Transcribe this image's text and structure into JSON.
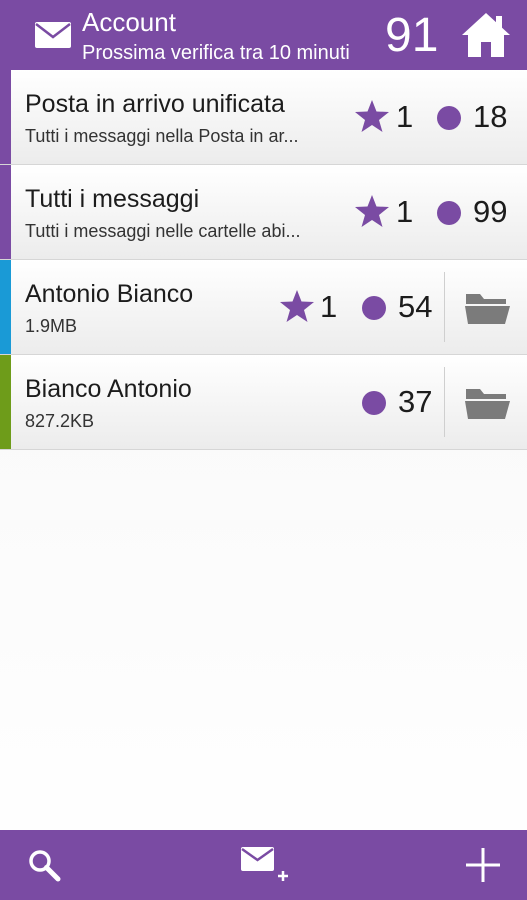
{
  "colors": {
    "brand": "#7a4ba3",
    "unified_stripe": "#7a4ba3",
    "all_stripe": "#7a4ba3",
    "account1_stripe": "#1a9ad6",
    "account2_stripe": "#6e9c1a",
    "badge": "#7a4ba3",
    "folder": "#7b7b7b"
  },
  "header": {
    "title": "Account",
    "subtitle": "Prossima verifica tra 10 minuti",
    "count": "91",
    "mail_icon": "mail-icon",
    "home_icon": "home-icon"
  },
  "accounts": [
    {
      "name": "Posta in arrivo unificata",
      "desc": "Tutti i messaggi nella Posta in ar...",
      "starred": "1",
      "unread": "18"
    },
    {
      "name": "Tutti i messaggi",
      "desc": "Tutti i messaggi nelle cartelle abi...",
      "starred": "1",
      "unread": "99"
    },
    {
      "name": "Antonio Bianco",
      "desc": "1.9MB",
      "starred": "1",
      "unread": "54",
      "icon": "folder-icon"
    },
    {
      "name": "Bianco Antonio",
      "desc": "827.2KB",
      "unread": "37",
      "icon": "folder-icon"
    }
  ],
  "bottom_bar": {
    "search_icon": "search-icon",
    "compose_icon": "compose-mail-icon",
    "add_icon": "add-icon"
  }
}
